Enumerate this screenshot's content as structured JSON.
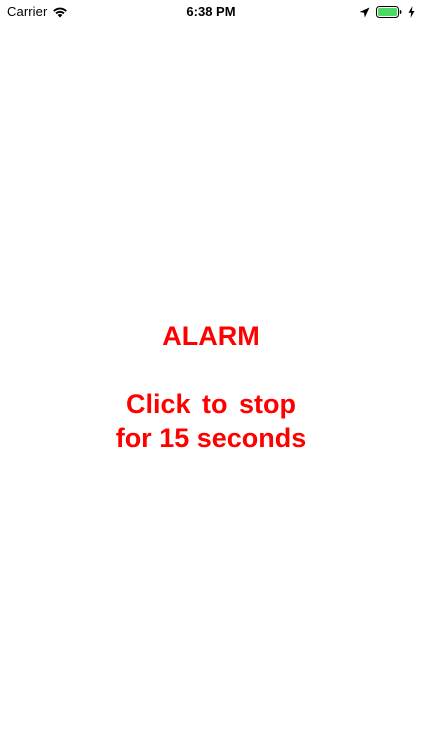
{
  "status_bar": {
    "carrier": "Carrier",
    "time": "6:38 PM",
    "icons": [
      "wifi-icon",
      "location-icon",
      "battery-icon",
      "charging-bolt-icon"
    ],
    "battery_color": "#4cd964"
  },
  "alarm": {
    "title": "ALARM",
    "action_line1": "Click  to  stop",
    "action_line2": "for 15 seconds",
    "text_color": "#ff0000"
  }
}
